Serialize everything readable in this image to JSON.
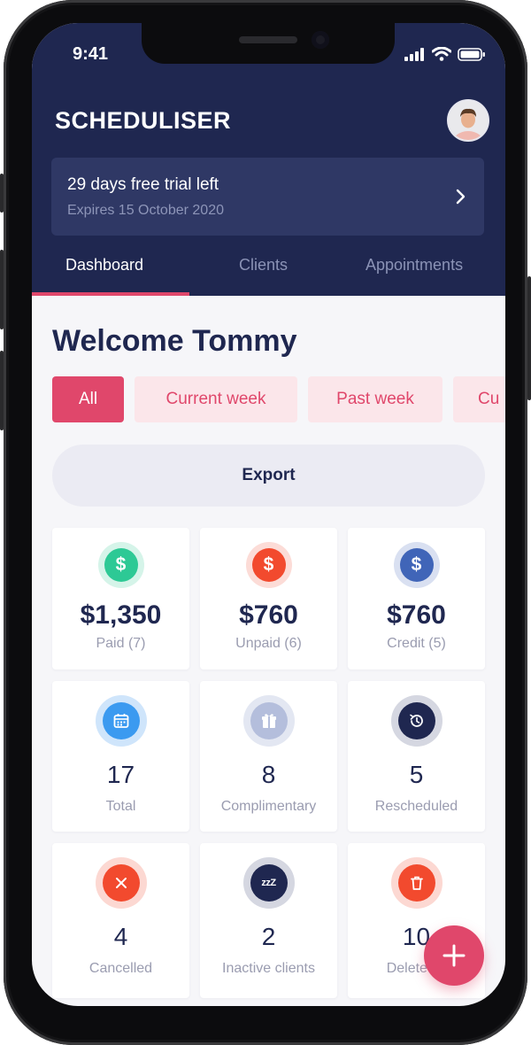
{
  "status_bar": {
    "time": "9:41"
  },
  "app": {
    "logo_text": "SCHEDULISER",
    "avatar": "user-avatar"
  },
  "trial_banner": {
    "title": "29 days free trial left",
    "subtitle": "Expires 15 October 2020",
    "icon": "chevron-right-icon"
  },
  "tabs": [
    {
      "label": "Dashboard",
      "active": true
    },
    {
      "label": "Clients",
      "active": false
    },
    {
      "label": "Appointments",
      "active": false
    }
  ],
  "main": {
    "welcome": "Welcome Tommy",
    "filters": [
      {
        "label": "All",
        "active": true
      },
      {
        "label": "Current week",
        "active": false
      },
      {
        "label": "Past week",
        "active": false
      },
      {
        "label": "Cu",
        "active": false
      }
    ],
    "export_label": "Export"
  },
  "stats": [
    {
      "value": "$1,350",
      "label": "Paid (7)",
      "icon": "dollar-icon",
      "color": "#2dc995"
    },
    {
      "value": "$760",
      "label": "Unpaid (6)",
      "icon": "dollar-icon",
      "color": "#f24a2e"
    },
    {
      "value": "$760",
      "label": "Credit (5)",
      "icon": "dollar-icon",
      "color": "#4065b8"
    },
    {
      "value": "17",
      "label": "Total",
      "icon": "calendar-icon",
      "color": "#3b9af0"
    },
    {
      "value": "8",
      "label": "Complimentary",
      "icon": "gift-icon",
      "color": "#b4bedc"
    },
    {
      "value": "5",
      "label": "Rescheduled",
      "icon": "history-icon",
      "color": "#1f2750"
    },
    {
      "value": "4",
      "label": "Cancelled",
      "icon": "close-icon",
      "color": "#f24a2e"
    },
    {
      "value": "2",
      "label": "Inactive clients",
      "icon": "sleep-icon",
      "color": "#1f2750"
    },
    {
      "value": "10",
      "label": "Deleted c",
      "icon": "trash-icon",
      "color": "#f24a2e"
    }
  ],
  "fab": {
    "icon": "plus-icon",
    "color": "#e0476b"
  },
  "colors": {
    "navy": "#1f2750",
    "accent": "#e0476b"
  }
}
